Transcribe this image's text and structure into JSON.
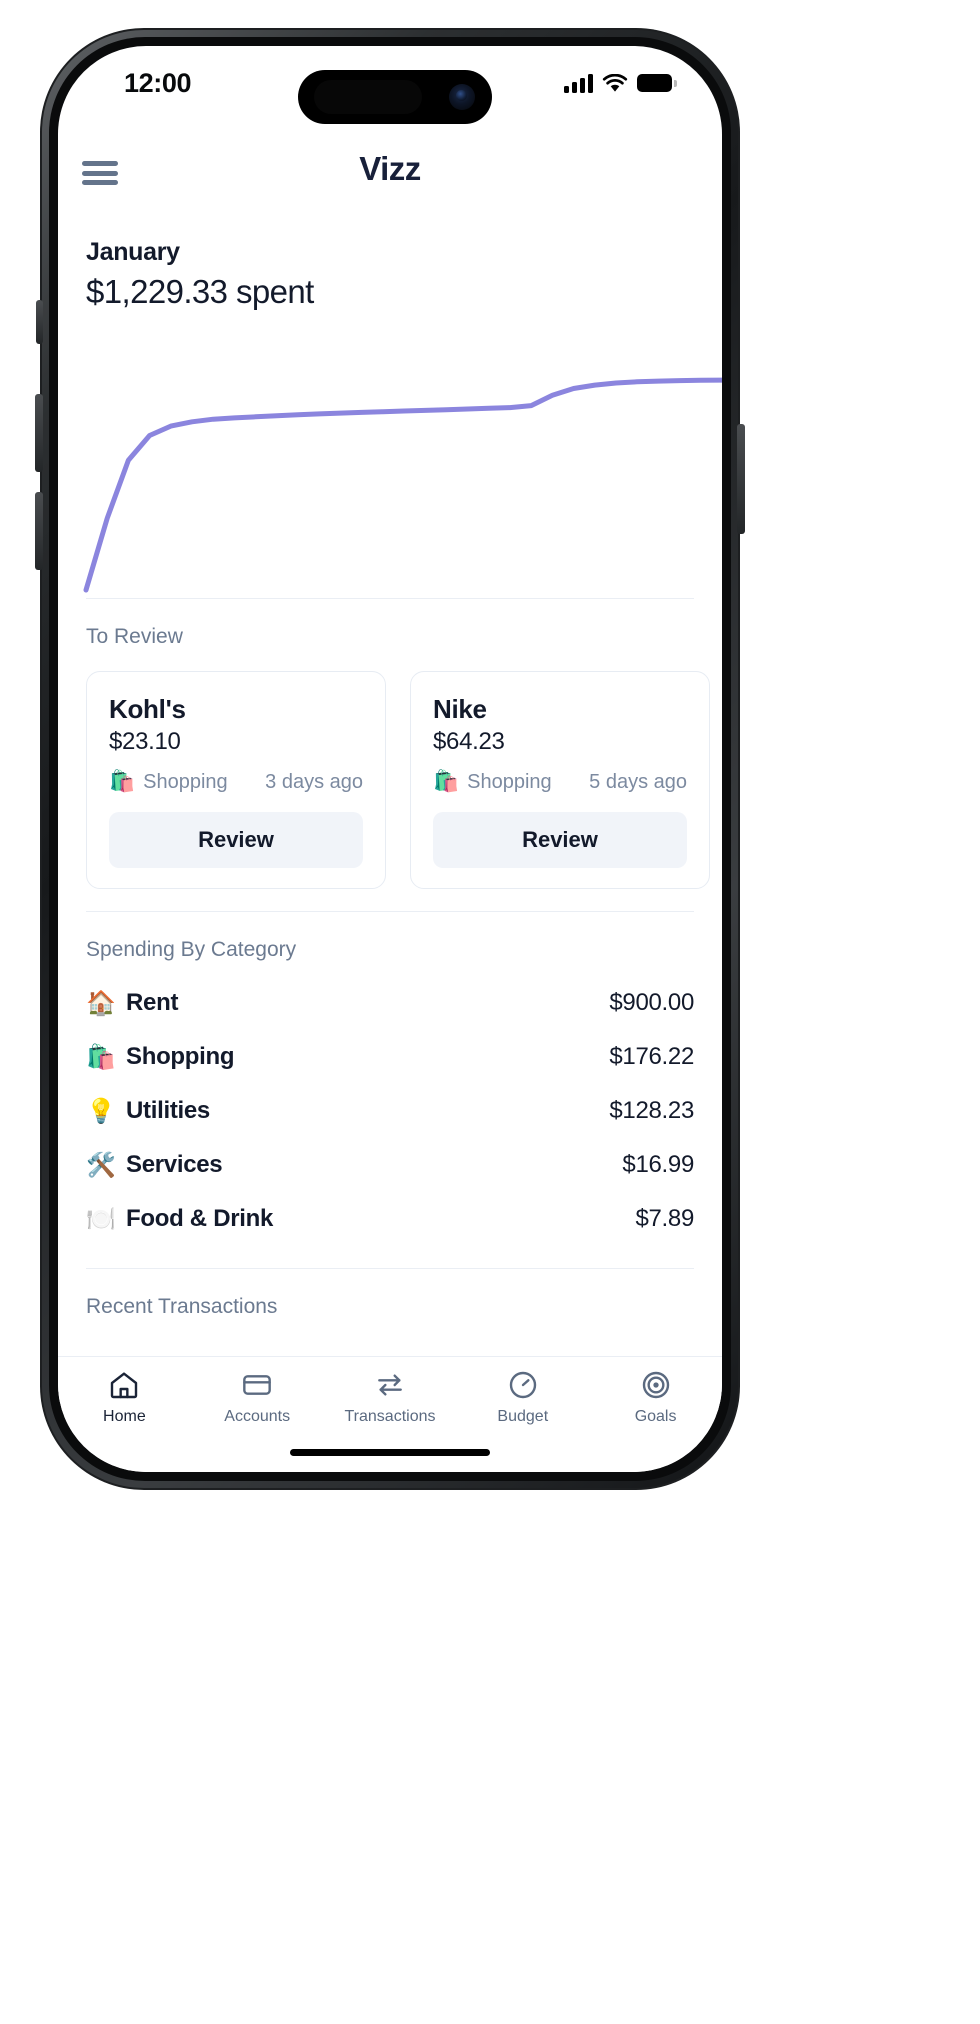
{
  "status_bar": {
    "time": "12:00",
    "signal_icon": "cellular-bars-icon",
    "wifi_icon": "wifi-icon",
    "battery_icon": "battery-full-icon"
  },
  "header": {
    "menu_icon": "hamburger-menu-icon",
    "title": "Vizz"
  },
  "summary": {
    "month": "January",
    "spent": "$1,229.33 spent"
  },
  "chart_data": {
    "type": "line",
    "title": "January cumulative spending",
    "xlabel": "",
    "ylabel": "",
    "grid": false,
    "legend": "none",
    "line_color": "#8b85de",
    "x": [
      0,
      1,
      2,
      3,
      4,
      5,
      6,
      7,
      8,
      9,
      10,
      11,
      12,
      13,
      14,
      15,
      16,
      17,
      18,
      19,
      20,
      21,
      22,
      23,
      24,
      25,
      26,
      27,
      28,
      29,
      30
    ],
    "values": [
      0,
      420,
      760,
      905,
      960,
      985,
      1000,
      1008,
      1014,
      1020,
      1026,
      1031,
      1036,
      1040,
      1044,
      1048,
      1052,
      1056,
      1060,
      1064,
      1068,
      1080,
      1140,
      1180,
      1200,
      1212,
      1219,
      1223,
      1226,
      1228,
      1229.33
    ],
    "ylim": [
      0,
      1300
    ],
    "xlim": [
      0,
      30
    ]
  },
  "to_review": {
    "label": "To Review",
    "cards": [
      {
        "merchant": "Kohl's",
        "amount": "$23.10",
        "category_emoji": "🛍️",
        "category": "Shopping",
        "when": "3 days ago",
        "button": "Review"
      },
      {
        "merchant": "Nike",
        "amount": "$64.23",
        "category_emoji": "🛍️",
        "category": "Shopping",
        "when": "5 days ago",
        "button": "Review"
      }
    ]
  },
  "spending_by_category": {
    "label": "Spending By Category",
    "rows": [
      {
        "emoji": "🏠",
        "name": "Rent",
        "amount": "$900.00"
      },
      {
        "emoji": "🛍️",
        "name": "Shopping",
        "amount": "$176.22"
      },
      {
        "emoji": "💡",
        "name": "Utilities",
        "amount": "$128.23"
      },
      {
        "emoji": "🛠️",
        "name": "Services",
        "amount": "$16.99"
      },
      {
        "emoji": "🍽️",
        "name": "Food & Drink",
        "amount": "$7.89"
      }
    ]
  },
  "recent_transactions": {
    "label": "Recent Transactions"
  },
  "tab_bar": {
    "items": [
      {
        "label": "Home",
        "icon": "home-icon",
        "active": true
      },
      {
        "label": "Accounts",
        "icon": "card-icon",
        "active": false
      },
      {
        "label": "Transactions",
        "icon": "transfer-icon",
        "active": false
      },
      {
        "label": "Budget",
        "icon": "gauge-icon",
        "active": false
      },
      {
        "label": "Goals",
        "icon": "target-icon",
        "active": false
      }
    ]
  },
  "colors": {
    "accent": "#8b85de",
    "text_dark": "#131a2b",
    "text_muted": "#6b7a90",
    "card_border": "#e7ecf3",
    "button_bg": "#f1f4f9"
  }
}
